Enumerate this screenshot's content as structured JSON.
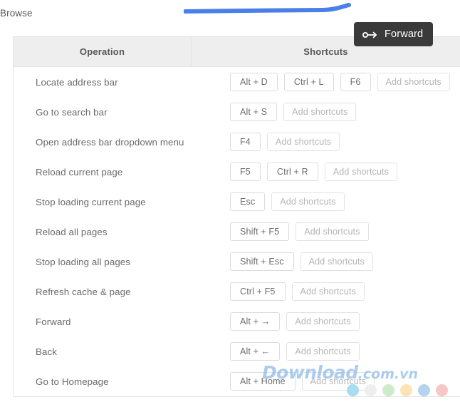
{
  "page": {
    "label": "Browse"
  },
  "tooltip": {
    "label": "Forward",
    "icon": "forward-link-icon",
    "background": "#3a3a3a",
    "text_color": "#ffffff"
  },
  "annotation": {
    "type": "brush-stroke",
    "color": "#4a7fe8"
  },
  "table": {
    "columns": [
      "Operation",
      "Shortcuts"
    ],
    "add_label": "Add shortcuts",
    "rows": [
      {
        "operation": "Locate address bar",
        "keys": [
          "Alt + D",
          "Ctrl + L",
          "F6"
        ]
      },
      {
        "operation": "Go to search bar",
        "keys": [
          "Alt + S"
        ]
      },
      {
        "operation": "Open address bar dropdown menu",
        "keys": [
          "F4"
        ]
      },
      {
        "operation": "Reload current page",
        "keys": [
          "F5",
          "Ctrl + R"
        ]
      },
      {
        "operation": "Stop loading current page",
        "keys": [
          "Esc"
        ]
      },
      {
        "operation": "Reload all pages",
        "keys": [
          "Shift + F5"
        ]
      },
      {
        "operation": "Stop loading all pages",
        "keys": [
          "Shift + Esc"
        ]
      },
      {
        "operation": "Refresh cache & page",
        "keys": [
          "Ctrl + F5"
        ]
      },
      {
        "operation": "Forward",
        "keys": [
          "Alt + →"
        ]
      },
      {
        "operation": "Back",
        "keys": [
          "Alt + ←"
        ]
      },
      {
        "operation": "Go to Homepage",
        "keys": [
          "Alt + Home"
        ]
      }
    ]
  },
  "watermark": {
    "brand": "Download",
    "suffix": ".com.vn",
    "color": "#8cb9e8",
    "dots": [
      "#a9dcf0",
      "#eeeeee",
      "#cdeccb",
      "#fce3b6",
      "#b3d4ef",
      "#f8c6c6"
    ]
  }
}
